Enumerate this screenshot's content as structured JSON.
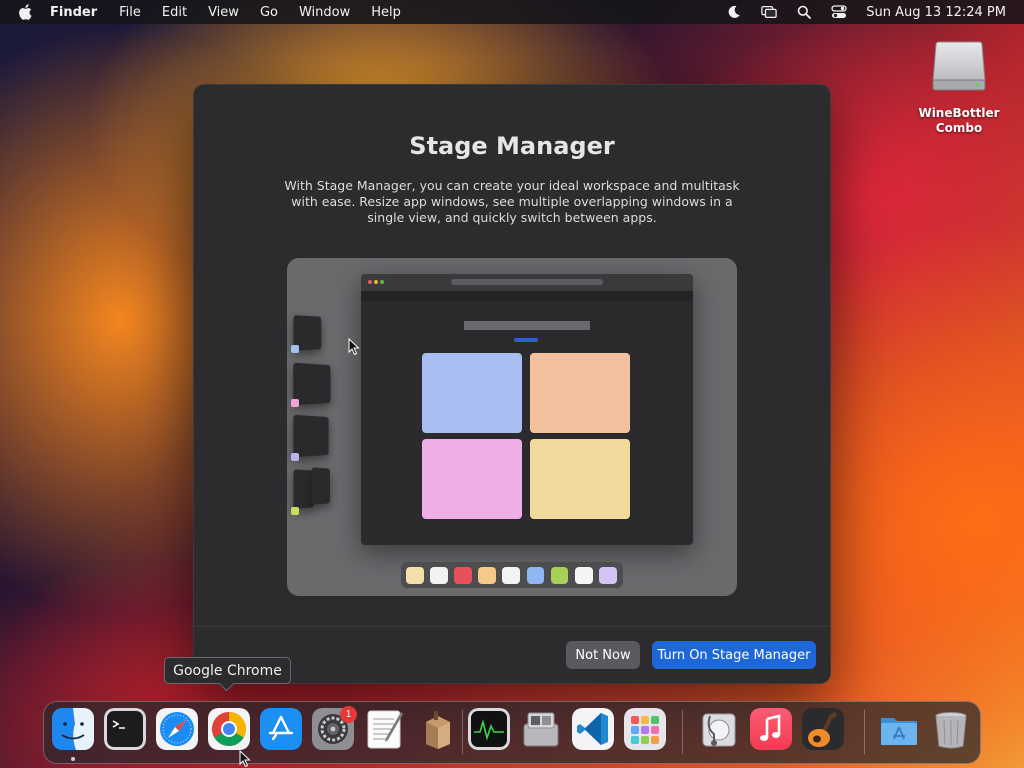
{
  "menubar": {
    "app_name": "Finder",
    "items": [
      "File",
      "Edit",
      "View",
      "Go",
      "Window",
      "Help"
    ],
    "status_icons": [
      "moon-icon",
      "screen-mirroring-icon",
      "spotlight-search-icon",
      "control-center-icon"
    ],
    "clock": "Sun Aug 13  12:24 PM"
  },
  "desktop": {
    "disk_label": "WineBottler Combo"
  },
  "dialog": {
    "title": "Stage Manager",
    "description": "With Stage Manager, you can create your ideal workspace and multitask with ease. Resize app windows, see multiple overlapping windows in a single view, and quickly switch between apps.",
    "secondary_button": "Not Now",
    "primary_button": "Turn On Stage Manager",
    "illustration": {
      "tile_colors": [
        "#a8bdf0",
        "#f3c09e",
        "#eeaee7",
        "#f2d99c"
      ],
      "stage_dot_colors": [
        "#9fc1f4",
        "#f0a3d6",
        "#b7b4ee",
        "#c6dd5e"
      ],
      "dock_swatches": [
        "#f4dfaa",
        "#f2f2f2",
        "#e9505c",
        "#f4c98a",
        "#f3f3f5",
        "#8fb7f3",
        "#a9d15a",
        "#f5f5f5",
        "#d3c5f4"
      ]
    }
  },
  "tooltip": {
    "text": "Google Chrome"
  },
  "dock": {
    "apps": [
      "Finder",
      "Terminal",
      "Safari",
      "Google Chrome",
      "App Store",
      "System Settings",
      "TextEdit",
      "WineBottler",
      "Activity Monitor",
      "Boot Camp Assistant",
      "Visual Studio Code",
      "Launchpad",
      "Disk Utility",
      "Music",
      "GarageBand",
      "Applications",
      "Trash"
    ],
    "system_settings_badge": "1"
  }
}
